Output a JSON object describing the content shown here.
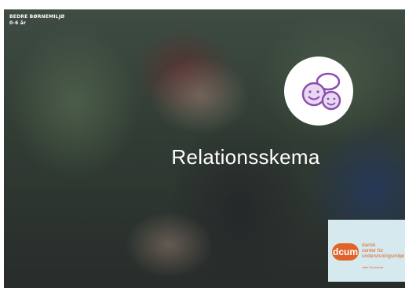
{
  "header": {
    "line1": "BEDRE BØRNEMILJØ",
    "line2": "0-6 år"
  },
  "main": {
    "title": "Relationsskema",
    "icon": "smiling-faces-icon"
  },
  "logo": {
    "mark": "dcum",
    "line1": "dansk",
    "line2": "center for",
    "line3": "undervisningsmiljø",
    "tagline": "viden til praksis"
  },
  "colors": {
    "logo_accent": "#e2632a",
    "logo_background": "#d6e9ee",
    "icon_accent": "#8a4fb0"
  }
}
